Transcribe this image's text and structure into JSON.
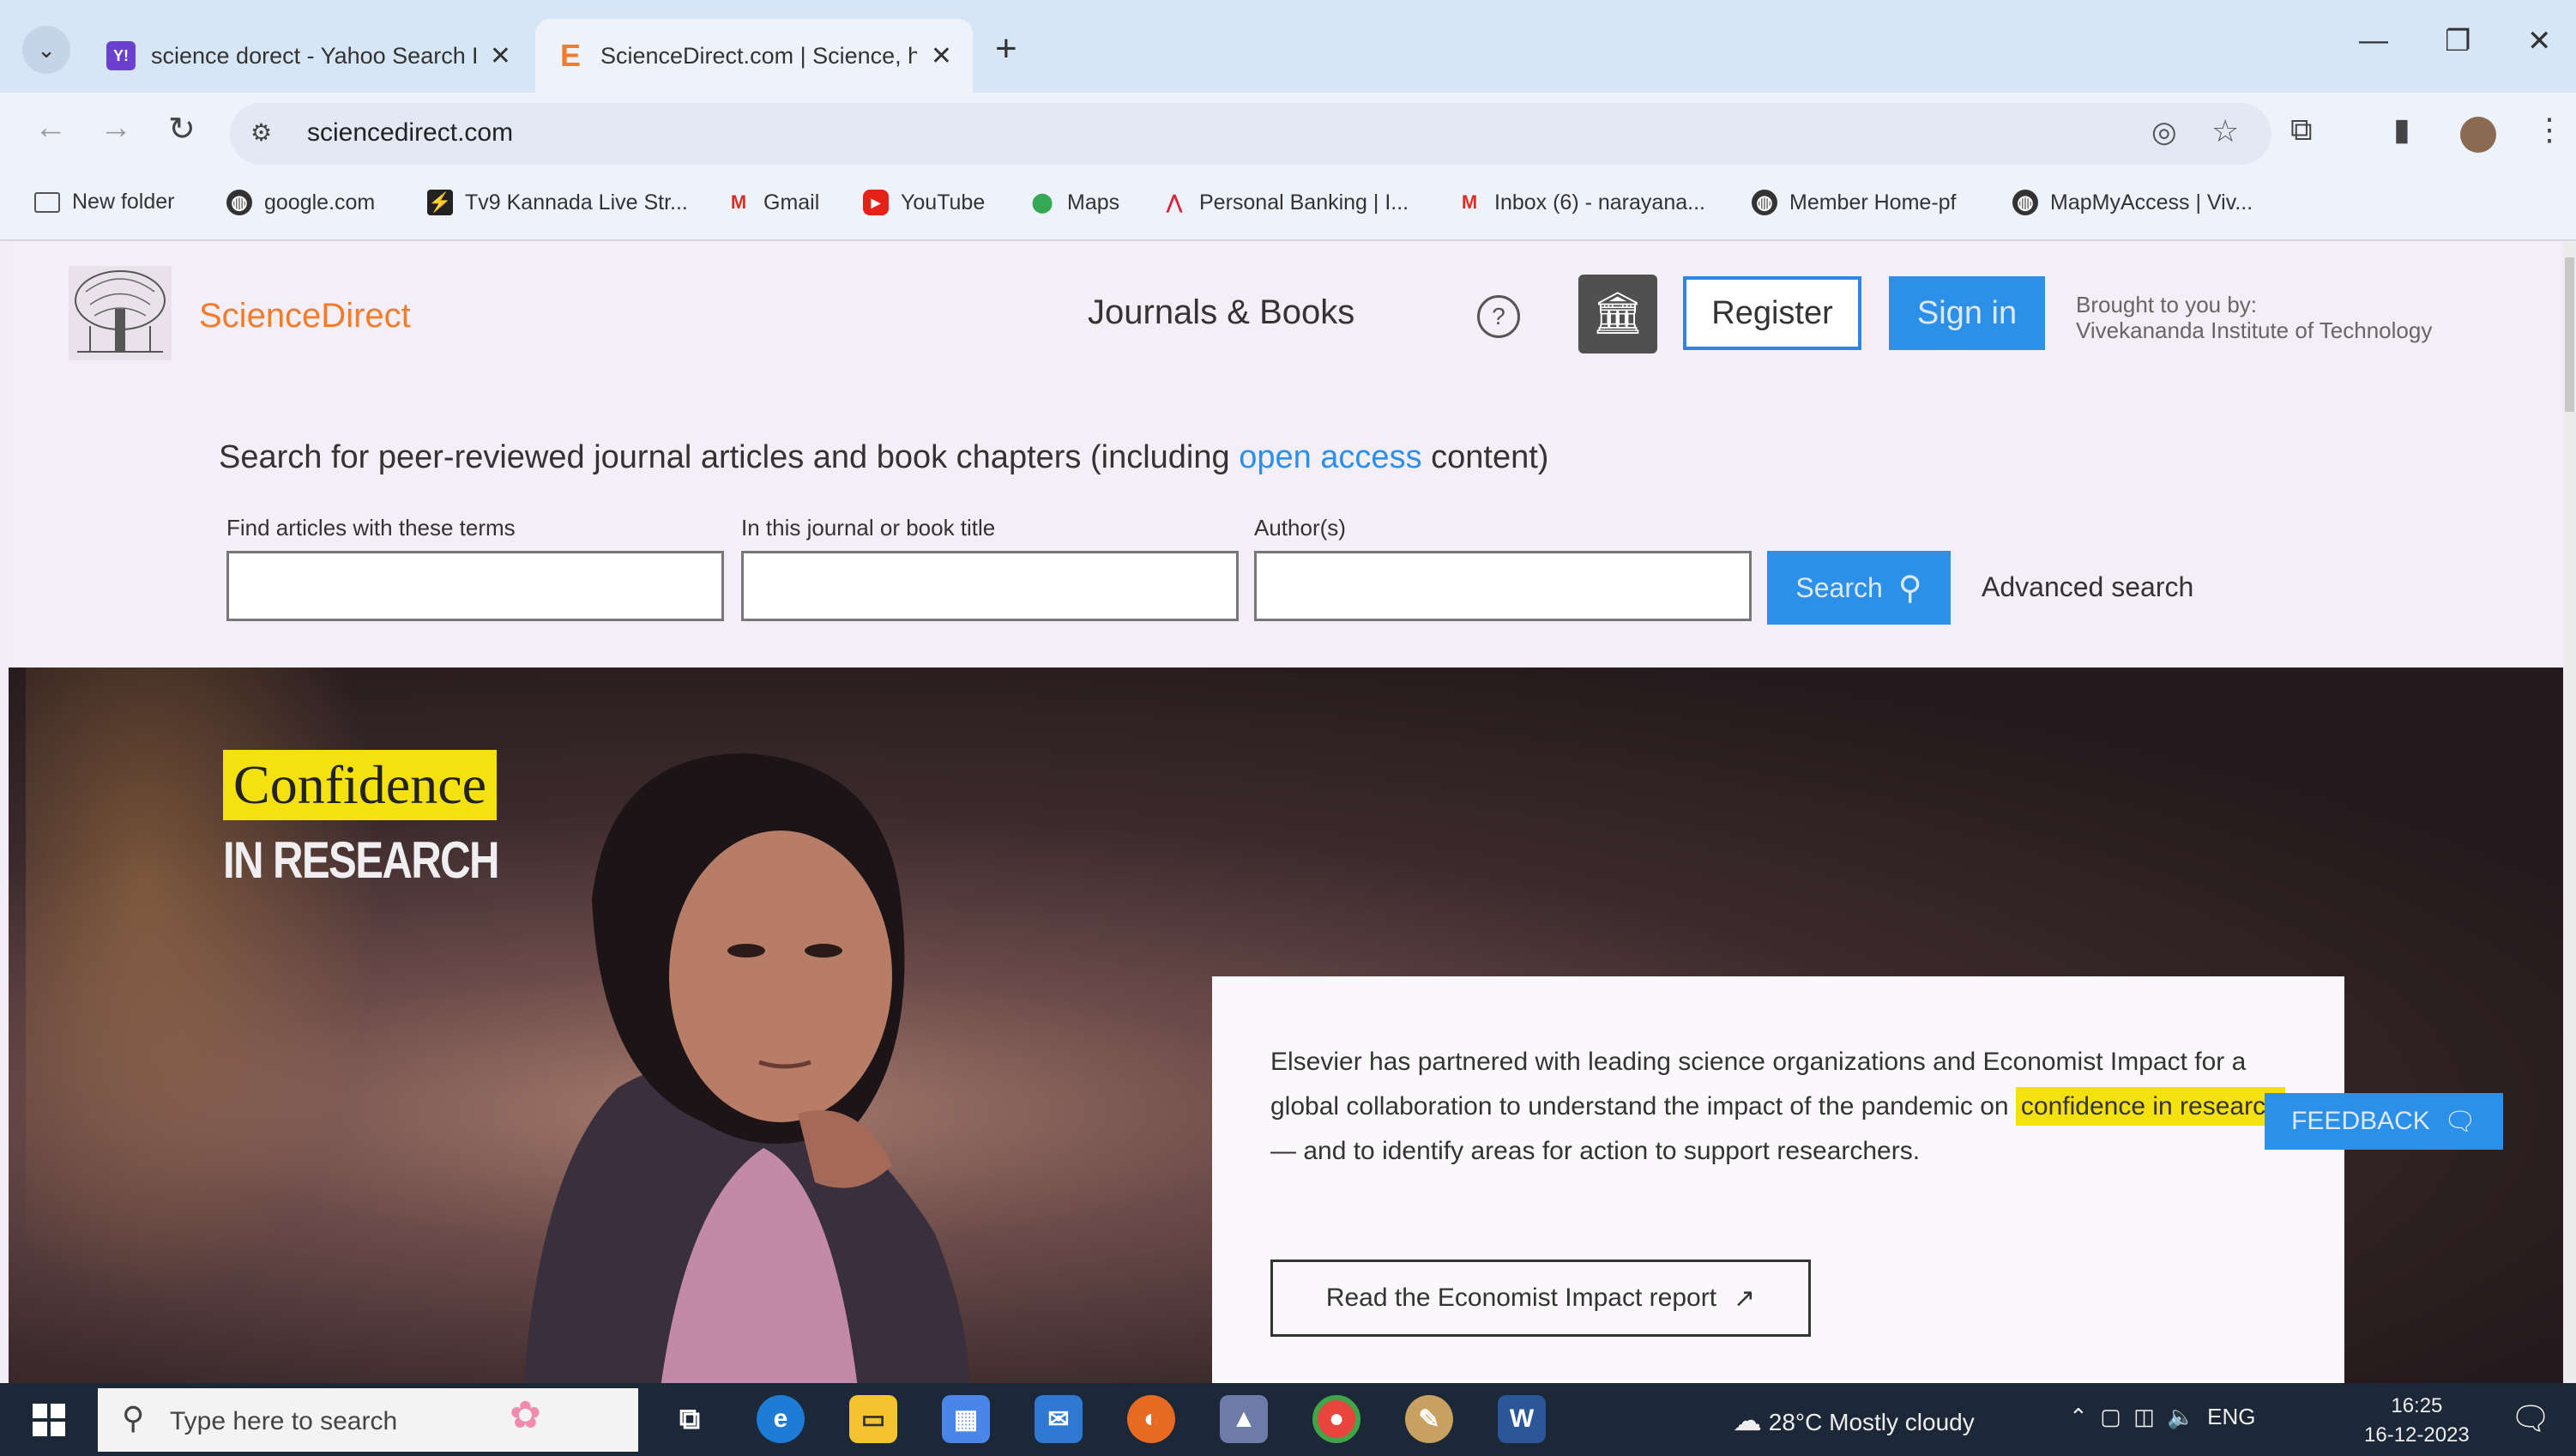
{
  "tabs": [
    {
      "title": "science dorect - Yahoo Search R",
      "favicon": "Y!",
      "color": "#6b3fd0"
    },
    {
      "title": "ScienceDirect.com | Science, he",
      "favicon": "E",
      "color": "#f37b29"
    }
  ],
  "toolbar": {
    "url": "sciencedirect.com"
  },
  "bookmarks": [
    {
      "label": "New folder",
      "icon": "folder-icon"
    },
    {
      "label": "google.com",
      "icon": "globe-icon"
    },
    {
      "label": "Tv9 Kannada Live Str...",
      "icon": "tv9-icon"
    },
    {
      "label": "Gmail",
      "icon": "gmail-icon"
    },
    {
      "label": "YouTube",
      "icon": "youtube-icon"
    },
    {
      "label": "Maps",
      "icon": "maps-icon"
    },
    {
      "label": "Personal Banking | I...",
      "icon": "bank-icon"
    },
    {
      "label": "Inbox (6) - narayana...",
      "icon": "gmail-icon"
    },
    {
      "label": "Member Home-pf",
      "icon": "globe-icon"
    },
    {
      "label": "MapMyAccess | Viv...",
      "icon": "globe-icon"
    }
  ],
  "header": {
    "brand": "ScienceDirect",
    "journals": "Journals & Books",
    "help": "?",
    "register": "Register",
    "signin": "Sign in",
    "brought_line1": "Brought to you by:",
    "brought_line2": "Vivekananda Institute of Technology"
  },
  "search": {
    "heading_pre": "Search for peer-reviewed journal articles and book chapters (including ",
    "heading_link": "open access",
    "heading_post": " content)",
    "label_terms": "Find articles with these terms",
    "label_journal": "In this journal or book title",
    "label_author": "Author(s)",
    "button": "Search",
    "advanced": "Advanced search"
  },
  "hero": {
    "title_line1": "Confidence",
    "title_line2": "IN RESEARCH",
    "card_pre": "Elsevier has partnered with leading science organizations and Economist Impact for a global collaboration to understand the impact of the pandemic on ",
    "card_highlight": "confidence in research",
    "card_post": " — and to identify areas for action to support researchers.",
    "cta": "Read the Economist Impact report"
  },
  "feedback": "FEEDBACK",
  "taskbar": {
    "search_placeholder": "Type here to search",
    "weather": "28°C  Mostly cloudy",
    "lang": "ENG",
    "time": "16:25",
    "date": "16-12-2023"
  },
  "colors": {
    "accent": "#2c8fe8",
    "brand": "#f37b29",
    "highlight": "#f5e10f"
  }
}
